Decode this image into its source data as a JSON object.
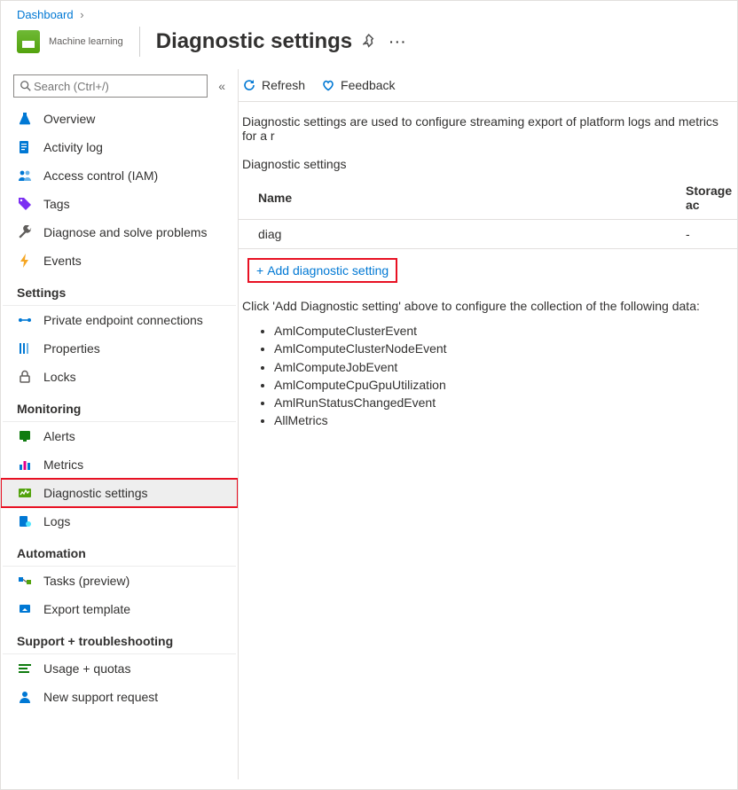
{
  "breadcrumb": {
    "dashboard": "Dashboard"
  },
  "resource": {
    "type_label": "Machine learning"
  },
  "title": "Diagnostic settings",
  "search": {
    "placeholder": "Search (Ctrl+/)"
  },
  "nav": {
    "top": [
      {
        "label": "Overview"
      },
      {
        "label": "Activity log"
      },
      {
        "label": "Access control (IAM)"
      },
      {
        "label": "Tags"
      },
      {
        "label": "Diagnose and solve problems"
      },
      {
        "label": "Events"
      }
    ],
    "settings_header": "Settings",
    "settings": [
      {
        "label": "Private endpoint connections"
      },
      {
        "label": "Properties"
      },
      {
        "label": "Locks"
      }
    ],
    "monitoring_header": "Monitoring",
    "monitoring": [
      {
        "label": "Alerts"
      },
      {
        "label": "Metrics"
      },
      {
        "label": "Diagnostic settings"
      },
      {
        "label": "Logs"
      }
    ],
    "automation_header": "Automation",
    "automation": [
      {
        "label": "Tasks (preview)"
      },
      {
        "label": "Export template"
      }
    ],
    "support_header": "Support + troubleshooting",
    "support": [
      {
        "label": "Usage + quotas"
      },
      {
        "label": "New support request"
      }
    ]
  },
  "toolbar": {
    "refresh": "Refresh",
    "feedback": "Feedback"
  },
  "description": "Diagnostic settings are used to configure streaming export of platform logs and metrics for a r",
  "table": {
    "caption": "Diagnostic settings",
    "col_name": "Name",
    "col_storage": "Storage ac",
    "rows": [
      {
        "name": "diag",
        "storage": "-"
      }
    ],
    "add_label": "Add diagnostic setting"
  },
  "hint": "Click 'Add Diagnostic setting' above to configure the collection of the following data:",
  "categories": [
    "AmlComputeClusterEvent",
    "AmlComputeClusterNodeEvent",
    "AmlComputeJobEvent",
    "AmlComputeCpuGpuUtilization",
    "AmlRunStatusChangedEvent",
    "AllMetrics"
  ]
}
